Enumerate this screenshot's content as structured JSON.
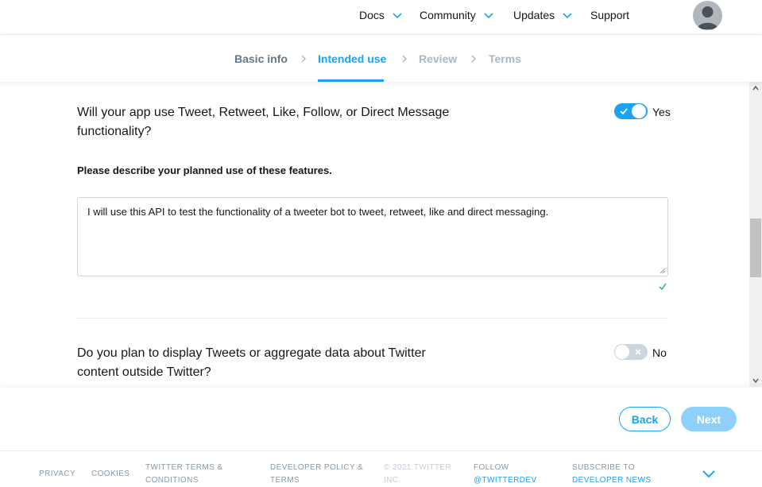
{
  "nav": {
    "items": [
      {
        "label": "Docs",
        "has_dropdown": true
      },
      {
        "label": "Community",
        "has_dropdown": true
      },
      {
        "label": "Updates",
        "has_dropdown": true
      },
      {
        "label": "Support",
        "has_dropdown": false
      }
    ],
    "avatar_icon": "user-avatar-icon"
  },
  "stepper": {
    "steps": [
      {
        "label": "Basic info",
        "state": "done"
      },
      {
        "label": "Intended use",
        "state": "active"
      },
      {
        "label": "Review",
        "state": "todo"
      },
      {
        "label": "Terms",
        "state": "todo"
      }
    ]
  },
  "form": {
    "q1": {
      "text": "Will your app use Tweet, Retweet, Like, Follow, or Direct Message functionality?",
      "toggle_on": true,
      "toggle_label": "Yes"
    },
    "describe": {
      "label": "Please describe your planned use of these features.",
      "value": "I will use this API to test the functionality of a tweeter bot to tweet, retweet, like and direct messaging.",
      "valid": true
    },
    "q2": {
      "text": "Do you plan to display Tweets or aggregate data about Twitter content outside Twitter?",
      "toggle_on": false,
      "toggle_label": "No"
    }
  },
  "actions": {
    "back_label": "Back",
    "next_label": "Next"
  },
  "footer": {
    "privacy": "Privacy",
    "cookies": "Cookies",
    "terms": "Twitter Terms & Conditions",
    "policy": "Developer Policy & Terms",
    "copyright": "© 2021 Twitter Inc.",
    "follow_prefix": "Follow",
    "follow_handle": "@TwitterDev",
    "subscribe_prefix": "Subscribe to",
    "subscribe_link": "Developer News"
  },
  "colors": {
    "accent": "#1da1f2",
    "accent_disabled": "#8ed0f9",
    "text": "#14171a",
    "muted": "#657786",
    "valid": "#17bf63"
  }
}
